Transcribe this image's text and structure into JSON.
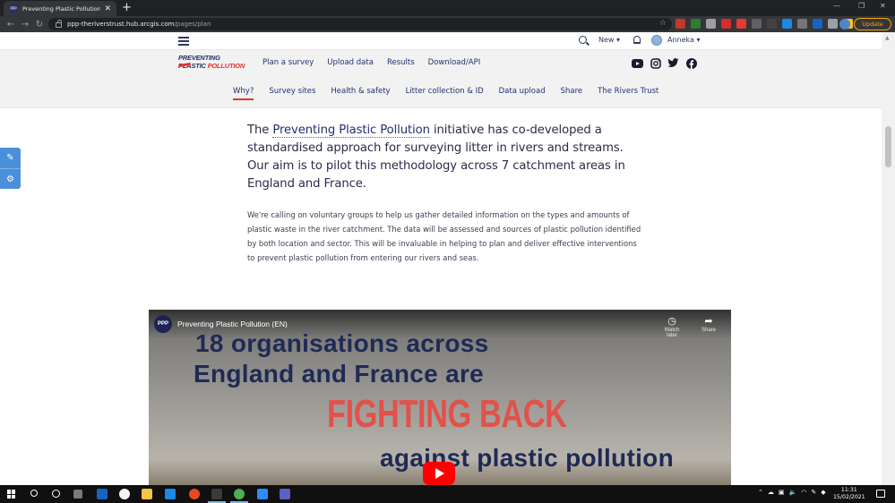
{
  "browser": {
    "tab_title": "Preventing Plastic Pollution – Pla",
    "tab_favicon": "PPP",
    "url_host": "ppp-theriverstrust.hub.arcgis.com",
    "url_path": "/pages/plan",
    "update_label": "Update"
  },
  "site": {
    "util": {
      "new_label": "New ▾",
      "user_label": "Anneka ▾"
    },
    "logo": {
      "line1_a": "PREVENTING",
      "line2_a": "PLASTIC ",
      "line2_b": "POLLUTION"
    },
    "main_nav": [
      "Plan a survey",
      "Upload data",
      "Results",
      "Download/API"
    ],
    "sub_nav": [
      {
        "label": "Why?",
        "active": true
      },
      {
        "label": "Survey sites"
      },
      {
        "label": "Health & safety"
      },
      {
        "label": "Litter collection & ID"
      },
      {
        "label": "Data upload"
      },
      {
        "label": "Share"
      },
      {
        "label": "The Rivers Trust"
      }
    ],
    "social": [
      "youtube-icon",
      "instagram-icon",
      "twitter-icon",
      "facebook-icon"
    ]
  },
  "content": {
    "lead_before": "The ",
    "lead_link": "Preventing Plastic Pollution",
    "lead_after": " initiative has co-developed a standardised approach for surveying litter in rivers and streams. Our aim is to pilot this methodology across 7 catchment areas in England and France.",
    "body": "We're calling on voluntary groups to help us gather detailed information on the types and amounts of plastic waste in the river catchment. The data will be assessed and sources of plastic pollution identified by both location and sector. This will be invaluable in helping to plan and deliver effective interventions to prevent plastic pollution from entering our rivers and seas."
  },
  "video": {
    "badge": "PPP",
    "title": "Preventing Plastic Pollution (EN)",
    "watch_later": "Watch later",
    "share": "Share",
    "line1": "18 organisations across",
    "line2": "England and France are",
    "line3": "FIGHTING BACK",
    "line4": "against plastic pollution"
  },
  "taskbar": {
    "clock_time": "11:31",
    "clock_date": "15/02/2021"
  },
  "colors": {
    "brand_navy": "#223070",
    "brand_red": "#e5322d",
    "youtube_red": "#ff0000"
  }
}
